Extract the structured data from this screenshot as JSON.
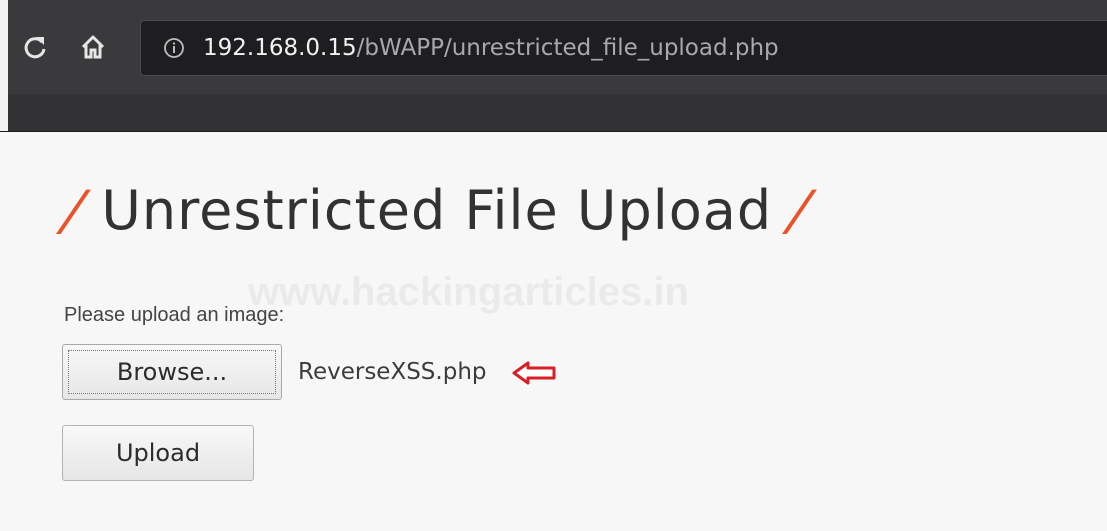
{
  "browser": {
    "url_host": "192.168.0.15",
    "url_path": "/bWAPP/unrestricted_file_upload.php",
    "icons": {
      "reload": "reload-icon",
      "home": "home-icon",
      "info": "info-icon"
    }
  },
  "page": {
    "title_slash_left": "/",
    "title": "Unrestricted File Upload",
    "title_slash_right": "/",
    "watermark": "www.hackingarticles.in",
    "prompt": "Please upload an image:",
    "browse_label": "Browse...",
    "selected_file": "ReverseXSS.php",
    "upload_label": "Upload",
    "annotation_icon": "left-arrow-icon"
  },
  "colors": {
    "accent_slash": "#e8532a",
    "annotation_arrow": "#d81f26",
    "chrome_bg": "#2b2b2d"
  }
}
